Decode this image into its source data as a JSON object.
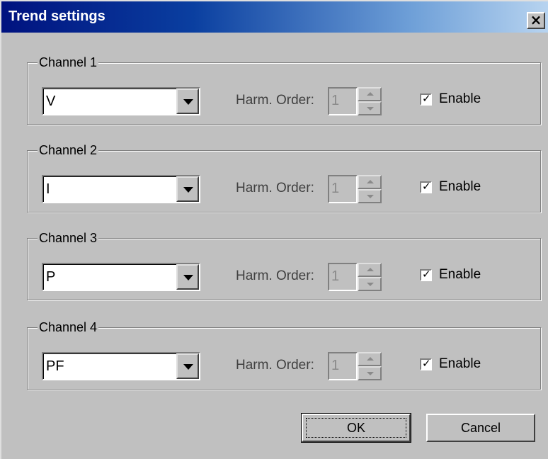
{
  "window": {
    "title": "Trend settings",
    "close_glyph": "✕"
  },
  "channels": [
    {
      "legend": "Channel 1",
      "value": "V",
      "harm_label": "Harm. Order:",
      "harm_value": "1",
      "enable_label": "Enable",
      "enabled": true
    },
    {
      "legend": "Channel 2",
      "value": "I",
      "harm_label": "Harm. Order:",
      "harm_value": "1",
      "enable_label": "Enable",
      "enabled": true
    },
    {
      "legend": "Channel 3",
      "value": "P",
      "harm_label": "Harm. Order:",
      "harm_value": "1",
      "enable_label": "Enable",
      "enabled": true
    },
    {
      "legend": "Channel 4",
      "value": "PF",
      "harm_label": "Harm. Order:",
      "harm_value": "1",
      "enable_label": "Enable",
      "enabled": true
    }
  ],
  "buttons": {
    "ok": "OK",
    "cancel": "Cancel"
  },
  "colors": {
    "title_bar_start": "#00127f",
    "title_bar_end": "#b8d4f0",
    "face": "#c0c0c0"
  }
}
